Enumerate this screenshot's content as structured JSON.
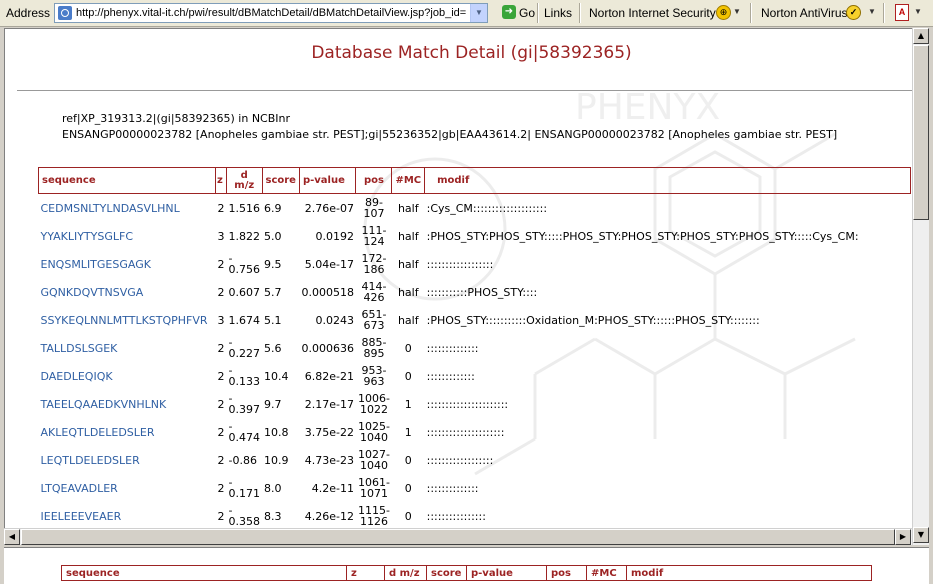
{
  "toolbar": {
    "address_label": "Address",
    "url": "http://phenyx.vital-it.ch/pwi/result/dBMatchDetail/dBMatchDetailView.jsp?job_id=",
    "go_label": "Go",
    "links_label": "Links",
    "norton_is_label": "Norton Internet Security",
    "norton_av_label": "Norton AntiVirus",
    "icons": [
      "page-icon",
      "go-arrow-icon",
      "norton-globe-icon",
      "norton-antivirus-icon",
      "pdf-icon"
    ]
  },
  "page": {
    "title": "Database Match Detail (gi|58392365)",
    "desc_line1": "ref|XP_319313.2|(gi|58392365) in NCBInr",
    "desc_line2": "ENSANGP00000023782 [Anopheles gambiae str. PEST];gi|55236352|gb|EAA43614.2| ENSANGP00000023782 [Anopheles gambiae str. PEST]",
    "watermark_text": "PHENYX"
  },
  "table": {
    "headers": {
      "sequence": "sequence",
      "z": "z",
      "dmz_line1": "d",
      "dmz_line2": "m/z",
      "score": "score",
      "pvalue": "p-value",
      "pos": "pos",
      "mc": "#MC",
      "modif": "modif"
    },
    "rows": [
      {
        "seq": "CEDMSNLTYLNDASVLHNL",
        "z": "2",
        "dmz1": "1.516",
        "dmz2": "",
        "score": "6.9",
        "pvalue": "2.76e-07",
        "pos1": "89-",
        "pos2": "107",
        "mc": "half",
        "modif": ":Cys_CM::::::::::::::::::::"
      },
      {
        "seq": "YYAKLIYTYSGLFC",
        "z": "3",
        "dmz1": "1.822",
        "dmz2": "",
        "score": "5.0",
        "pvalue": "0.0192",
        "pos1": "111-",
        "pos2": "124",
        "mc": "half",
        "modif": ":PHOS_STY:PHOS_STY:::::PHOS_STY:PHOS_STY:PHOS_STY:PHOS_STY:::::Cys_CM:"
      },
      {
        "seq": "ENQSMLITGESGAGK",
        "z": "2",
        "dmz1": "-",
        "dmz2": "0.756",
        "score": "9.5",
        "pvalue": "5.04e-17",
        "pos1": "172-",
        "pos2": "186",
        "mc": "half",
        "modif": "::::::::::::::::::"
      },
      {
        "seq": "GQNKDQVTNSVGA",
        "z": "2",
        "dmz1": "0.607",
        "dmz2": "",
        "score": "5.7",
        "pvalue": "0.000518",
        "pos1": "414-",
        "pos2": "426",
        "mc": "half",
        "modif": ":::::::::::PHOS_STY::::"
      },
      {
        "seq": "SSYKEQLNNLMTTLKSTQPHFVR",
        "z": "3",
        "dmz1": "1.674",
        "dmz2": "",
        "score": "5.1",
        "pvalue": "0.0243",
        "pos1": "651-",
        "pos2": "673",
        "mc": "half",
        "modif": ":PHOS_STY:::::::::::Oxidation_M:PHOS_STY::::::PHOS_STY::::::::"
      },
      {
        "seq": "TALLDSLSGEK",
        "z": "2",
        "dmz1": "-",
        "dmz2": "0.227",
        "score": "5.6",
        "pvalue": "0.000636",
        "pos1": "885-",
        "pos2": "895",
        "mc": "0",
        "modif": "::::::::::::::"
      },
      {
        "seq": "DAEDLEQIQK",
        "z": "2",
        "dmz1": "-",
        "dmz2": "0.133",
        "score": "10.4",
        "pvalue": "6.82e-21",
        "pos1": "953-",
        "pos2": "963",
        "mc": "0",
        "modif": ":::::::::::::"
      },
      {
        "seq": "TAEELQAAEDKVNHLNK",
        "z": "2",
        "dmz1": "-",
        "dmz2": "0.397",
        "score": "9.7",
        "pvalue": "2.17e-17",
        "pos1": "1006-",
        "pos2": "1022",
        "mc": "1",
        "modif": "::::::::::::::::::::::"
      },
      {
        "seq": "AKLEQTLDELEDSLER",
        "z": "2",
        "dmz1": "-",
        "dmz2": "0.474",
        "score": "10.8",
        "pvalue": "3.75e-22",
        "pos1": "1025-",
        "pos2": "1040",
        "mc": "1",
        "modif": ":::::::::::::::::::::"
      },
      {
        "seq": "LEQTLDELEDSLER",
        "z": "2",
        "dmz1": "-0.86",
        "dmz2": "",
        "score": "10.9",
        "pvalue": "4.73e-23",
        "pos1": "1027-",
        "pos2": "1040",
        "mc": "0",
        "modif": "::::::::::::::::::"
      },
      {
        "seq": "LTQEAVADLER",
        "z": "2",
        "dmz1": "-",
        "dmz2": "0.171",
        "score": "8.0",
        "pvalue": "4.2e-11",
        "pos1": "1061-",
        "pos2": "1071",
        "mc": "0",
        "modif": "::::::::::::::"
      },
      {
        "seq": "IEELEEEVEAER",
        "z": "2",
        "dmz1": "-",
        "dmz2": "0.358",
        "score": "8.3",
        "pvalue": "4.26e-12",
        "pos1": "1115-",
        "pos2": "1126",
        "mc": "0",
        "modif": "::::::::::::::::"
      }
    ]
  },
  "table2": {
    "headers": {
      "sequence": "sequence",
      "z": "z",
      "dmz": "d m/z",
      "score": "score",
      "pvalue": "p-value",
      "pos": "pos",
      "mc": "#MC",
      "modif": "modif"
    }
  },
  "colors": {
    "accent": "#9c2323",
    "link": "#2f5fa3",
    "chrome": "#d4d0c8"
  }
}
